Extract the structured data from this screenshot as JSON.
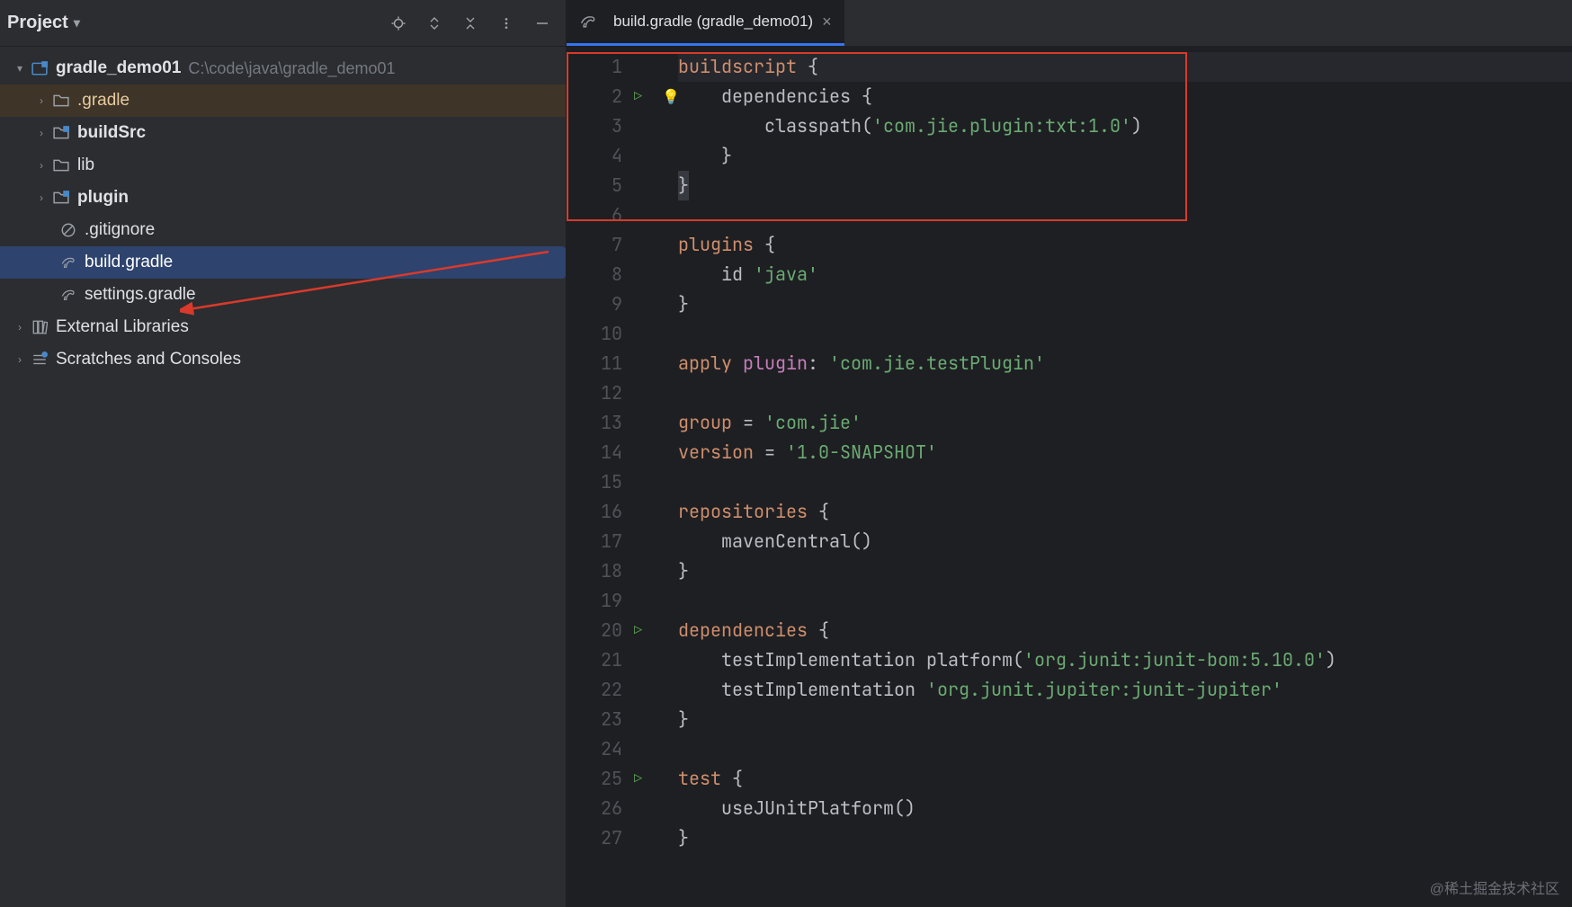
{
  "sidebar": {
    "title": "Project",
    "root": {
      "label": "gradle_demo01",
      "path": "C:\\code\\java\\gradle_demo01"
    },
    "items": [
      {
        "label": ".gradle",
        "kind": "folder",
        "highlight": true
      },
      {
        "label": "buildSrc",
        "kind": "module"
      },
      {
        "label": "lib",
        "kind": "folder"
      },
      {
        "label": "plugin",
        "kind": "module"
      },
      {
        "label": ".gitignore",
        "kind": "file-ignored"
      },
      {
        "label": "build.gradle",
        "kind": "gradle",
        "selected": true
      },
      {
        "label": "settings.gradle",
        "kind": "gradle"
      }
    ],
    "extras": [
      {
        "label": "External Libraries"
      },
      {
        "label": "Scratches and Consoles"
      }
    ]
  },
  "tab": {
    "title": "build.gradle (gradle_demo01)"
  },
  "code": {
    "lines": [
      {
        "n": 1,
        "segs": [
          [
            "kw",
            "buildscript "
          ],
          [
            "br",
            "{"
          ]
        ],
        "hl": true
      },
      {
        "n": 2,
        "run": true,
        "bulb": true,
        "segs": [
          [
            "fn",
            "    dependencies "
          ],
          [
            "br",
            "{"
          ]
        ]
      },
      {
        "n": 3,
        "segs": [
          [
            "fn",
            "        classpath("
          ],
          [
            "str",
            "'com.jie.plugin:txt:1.0'"
          ],
          [
            "fn",
            ")"
          ]
        ]
      },
      {
        "n": 4,
        "segs": [
          [
            "br",
            "    }"
          ]
        ]
      },
      {
        "n": 5,
        "segs": [
          [
            "br",
            "}"
          ]
        ],
        "caret": true
      },
      {
        "n": 6,
        "segs": []
      },
      {
        "n": 7,
        "segs": [
          [
            "kw",
            "plugins "
          ],
          [
            "br",
            "{"
          ]
        ]
      },
      {
        "n": 8,
        "segs": [
          [
            "fn",
            "    id "
          ],
          [
            "str",
            "'java'"
          ]
        ]
      },
      {
        "n": 9,
        "segs": [
          [
            "br",
            "}"
          ]
        ]
      },
      {
        "n": 10,
        "segs": []
      },
      {
        "n": 11,
        "segs": [
          [
            "kw",
            "apply "
          ],
          [
            "id",
            "plugin"
          ],
          [
            "fn",
            ": "
          ],
          [
            "str",
            "'com.jie.testPlugin'"
          ]
        ]
      },
      {
        "n": 12,
        "segs": []
      },
      {
        "n": 13,
        "segs": [
          [
            "kw",
            "group "
          ],
          [
            "fn",
            "= "
          ],
          [
            "str",
            "'com.jie'"
          ]
        ]
      },
      {
        "n": 14,
        "segs": [
          [
            "kw",
            "version "
          ],
          [
            "fn",
            "= "
          ],
          [
            "str",
            "'1.0-SNAPSHOT'"
          ]
        ]
      },
      {
        "n": 15,
        "segs": []
      },
      {
        "n": 16,
        "segs": [
          [
            "kw",
            "repositories "
          ],
          [
            "br",
            "{"
          ]
        ]
      },
      {
        "n": 17,
        "segs": [
          [
            "fn",
            "    mavenCentral()"
          ]
        ]
      },
      {
        "n": 18,
        "segs": [
          [
            "br",
            "}"
          ]
        ]
      },
      {
        "n": 19,
        "segs": []
      },
      {
        "n": 20,
        "run": true,
        "segs": [
          [
            "kw",
            "dependencies "
          ],
          [
            "br",
            "{"
          ]
        ]
      },
      {
        "n": 21,
        "segs": [
          [
            "fn",
            "    testImplementation platform("
          ],
          [
            "str",
            "'org.junit:junit-bom:5.10.0'"
          ],
          [
            "fn",
            ")"
          ]
        ]
      },
      {
        "n": 22,
        "segs": [
          [
            "fn",
            "    testImplementation "
          ],
          [
            "str",
            "'org.junit.jupiter:junit-jupiter'"
          ]
        ]
      },
      {
        "n": 23,
        "segs": [
          [
            "br",
            "}"
          ]
        ]
      },
      {
        "n": 24,
        "segs": []
      },
      {
        "n": 25,
        "run": true,
        "segs": [
          [
            "kw",
            "test "
          ],
          [
            "br",
            "{"
          ]
        ]
      },
      {
        "n": 26,
        "segs": [
          [
            "fn",
            "    useJUnitPlatform()"
          ]
        ]
      },
      {
        "n": 27,
        "segs": [
          [
            "br",
            "}"
          ]
        ]
      }
    ]
  },
  "watermark": "@稀土掘金技术社区"
}
